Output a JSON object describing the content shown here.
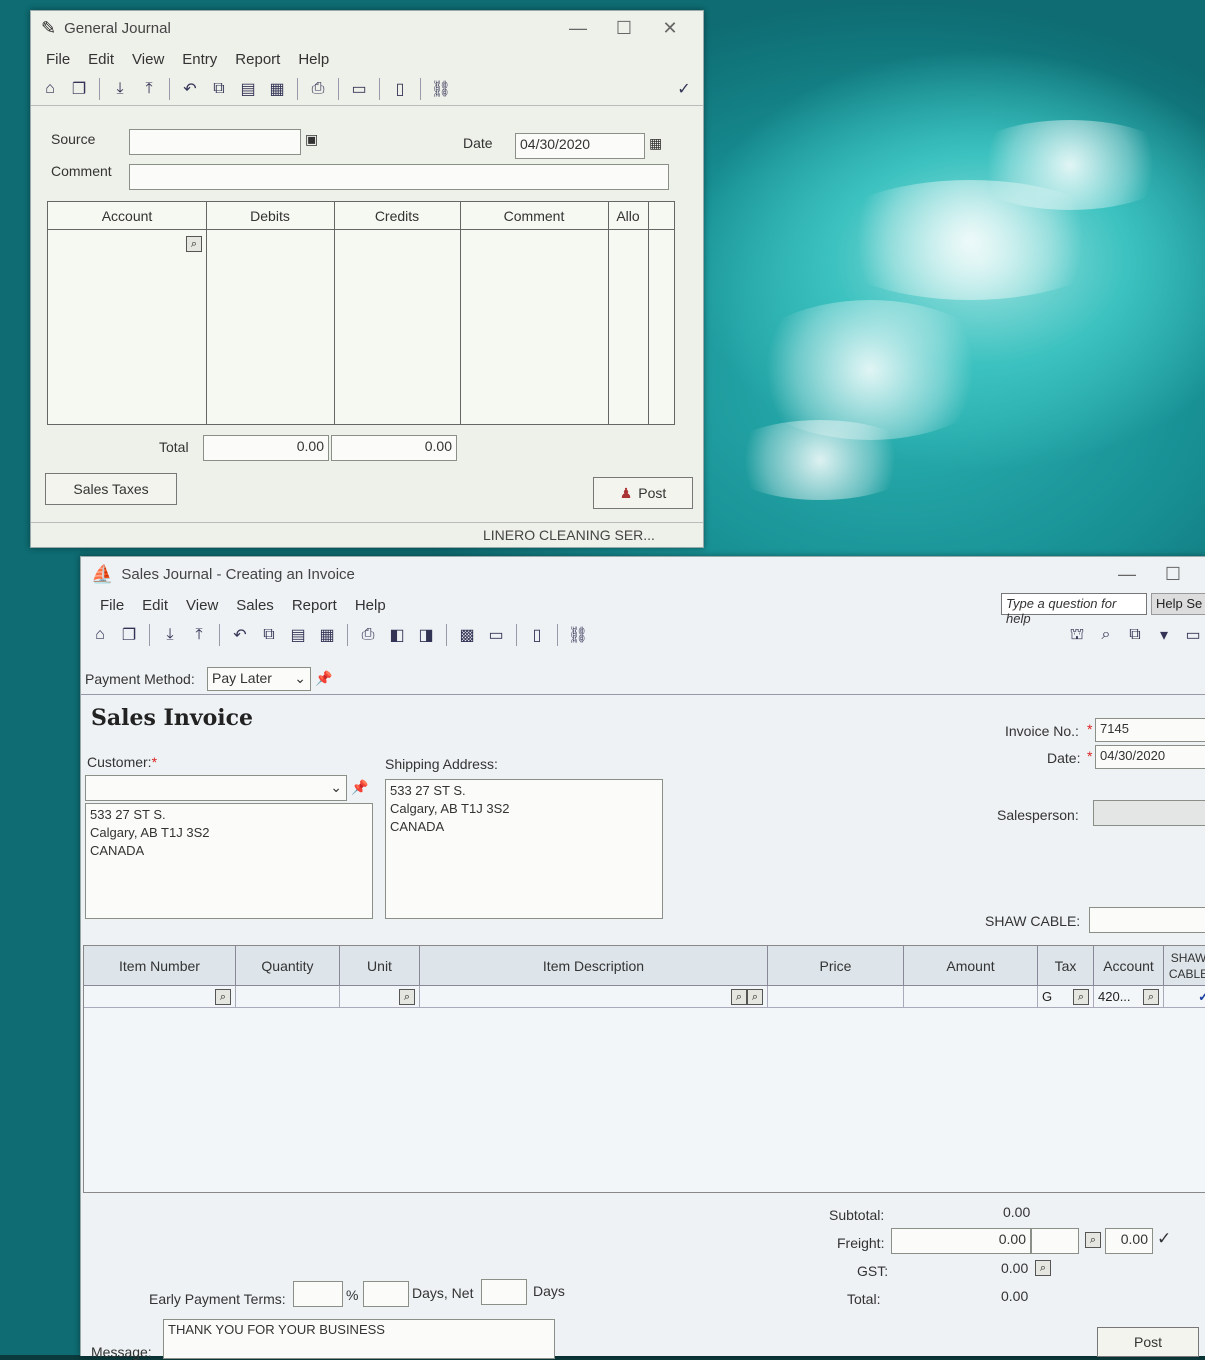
{
  "general_journal": {
    "title": "General Journal",
    "menu": [
      "File",
      "Edit",
      "View",
      "Entry",
      "Report",
      "Help"
    ],
    "source_label": "Source",
    "source_value": "",
    "date_label": "Date",
    "date_value": "04/30/2020",
    "comment_label": "Comment",
    "comment_value": "",
    "columns": [
      "Account",
      "Debits",
      "Credits",
      "Comment",
      "Allo"
    ],
    "total_label": "Total",
    "total_debits": "0.00",
    "total_credits": "0.00",
    "sales_taxes_button": "Sales Taxes",
    "post_button": "Post",
    "status_company": "LINERO CLEANING SER..."
  },
  "sales_journal": {
    "title": "Sales Journal - Creating an Invoice",
    "menu": [
      "File",
      "Edit",
      "View",
      "Sales",
      "Report",
      "Help"
    ],
    "help_search_placeholder": "Type a question for help",
    "help_search_button": "Help Se",
    "payment_method_label": "Payment Method:",
    "payment_method_value": "Pay Later",
    "heading": "Sales Invoice",
    "invoice_no_label": "Invoice No.:",
    "invoice_no_value": "7145",
    "date_label": "Date:",
    "date_value": "04/30/2020",
    "salesperson_label": "Salesperson:",
    "shaw_cable_label": "SHAW CABLE:",
    "customer_label": "Customer:",
    "customer_value": "",
    "customer_address": [
      "533 27 ST S.",
      "Calgary, AB  T1J 3S2",
      "CANADA"
    ],
    "shipping_label": "Shipping Address:",
    "shipping_address": [
      "533 27 ST S.",
      "Calgary, AB  T1J 3S2",
      "CANADA"
    ],
    "columns": [
      "Item Number",
      "Quantity",
      "Unit",
      "Item Description",
      "Price",
      "Amount",
      "Tax",
      "Account",
      "SHAW CABLE"
    ],
    "row1": {
      "tax": "G",
      "account": "420..."
    },
    "subtotal_label": "Subtotal:",
    "subtotal_value": "0.00",
    "freight_label": "Freight:",
    "freight_value": "0.00",
    "freight_tax_value": "0.00",
    "gst_label": "GST:",
    "gst_value": "0.00",
    "total_label": "Total:",
    "total_value": "0.00",
    "early_payment_label": "Early Payment Terms:",
    "percent_label": "%",
    "days_net_label": "Days, Net",
    "days_label": "Days",
    "message_label": "Message:",
    "message_value": "THANK YOU FOR YOUR BUSINESS",
    "post_button": "Post"
  }
}
